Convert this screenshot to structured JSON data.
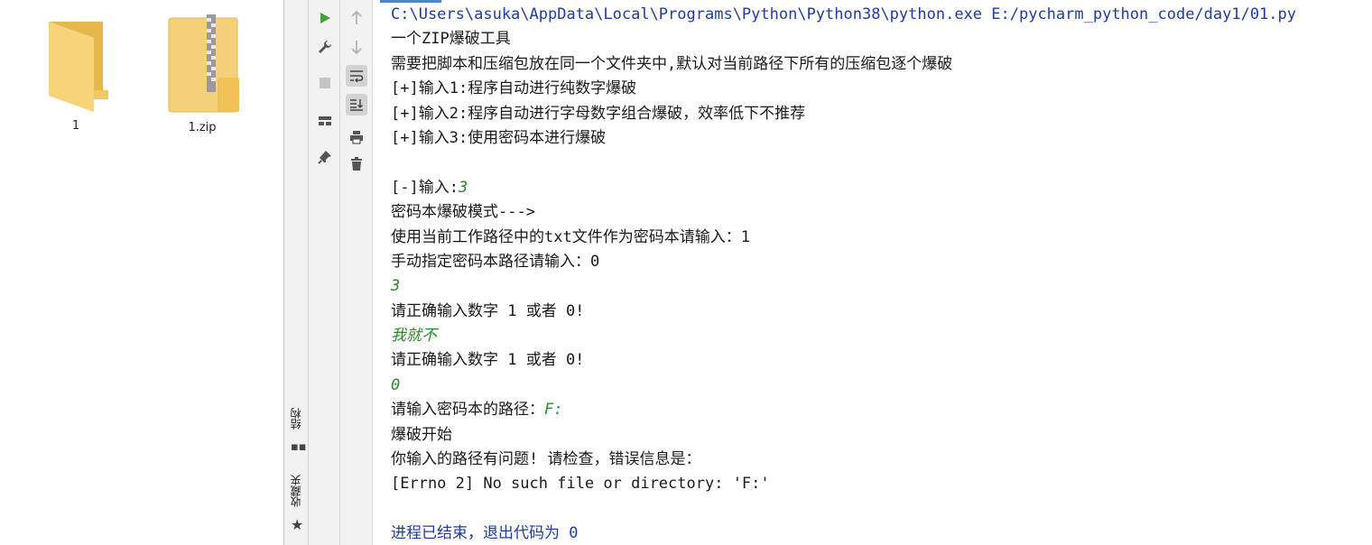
{
  "desktop": {
    "items": [
      {
        "label": "1",
        "icon": "folder-icon"
      },
      {
        "label": "1.zip",
        "icon": "zip-folder-icon"
      }
    ]
  },
  "side_tabs": {
    "structure": "结构",
    "favorites": "收藏夹"
  },
  "console": {
    "lines": [
      {
        "text": "C:\\Users\\asuka\\AppData\\Local\\Programs\\Python\\Python38\\python.exe E:/pycharm_python_code/day1/01.py",
        "style": "blue"
      },
      {
        "text": "一个ZIP爆破工具",
        "style": "normal"
      },
      {
        "text": "需要把脚本和压缩包放在同一个文件夹中,默认对当前路径下所有的压缩包逐个爆破",
        "style": "normal"
      },
      {
        "text": "[+]输入1:程序自动进行纯数字爆破",
        "style": "normal"
      },
      {
        "text": "[+]输入2:程序自动进行字母数字组合爆破，效率低下不推荐",
        "style": "normal"
      },
      {
        "text": "[+]输入3:使用密码本进行爆破",
        "style": "normal"
      },
      {
        "text": "",
        "style": "normal"
      },
      {
        "text": "[-]输入:",
        "input": "3",
        "style": "normal"
      },
      {
        "text": "密码本爆破模式--->",
        "style": "normal"
      },
      {
        "text": "使用当前工作路径中的txt文件作为密码本请输入：1",
        "style": "normal"
      },
      {
        "text": "手动指定密码本路径请输入：0",
        "style": "normal"
      },
      {
        "text": "3",
        "style": "green"
      },
      {
        "text": "请正确输入数字 1 或者 0!",
        "style": "normal"
      },
      {
        "text": "我就不",
        "style": "green"
      },
      {
        "text": "请正确输入数字 1 或者 0!",
        "style": "normal"
      },
      {
        "text": "0",
        "style": "green"
      },
      {
        "text": "请输入密码本的路径：",
        "input": "F:",
        "style": "normal"
      },
      {
        "text": "爆破开始",
        "style": "normal"
      },
      {
        "text": "你输入的路径有问题! 请检查，错误信息是：",
        "style": "normal"
      },
      {
        "text": "[Errno 2] No such file or directory: 'F:'",
        "style": "normal"
      },
      {
        "text": "",
        "style": "normal"
      },
      {
        "text": "进程已结束，退出代码为 0",
        "style": "blue"
      }
    ]
  },
  "colors": {
    "run_green": "#3aa63a",
    "output_blue": "#1f3ba8",
    "input_green": "#2b8a2b",
    "accent": "#4a86c8"
  }
}
